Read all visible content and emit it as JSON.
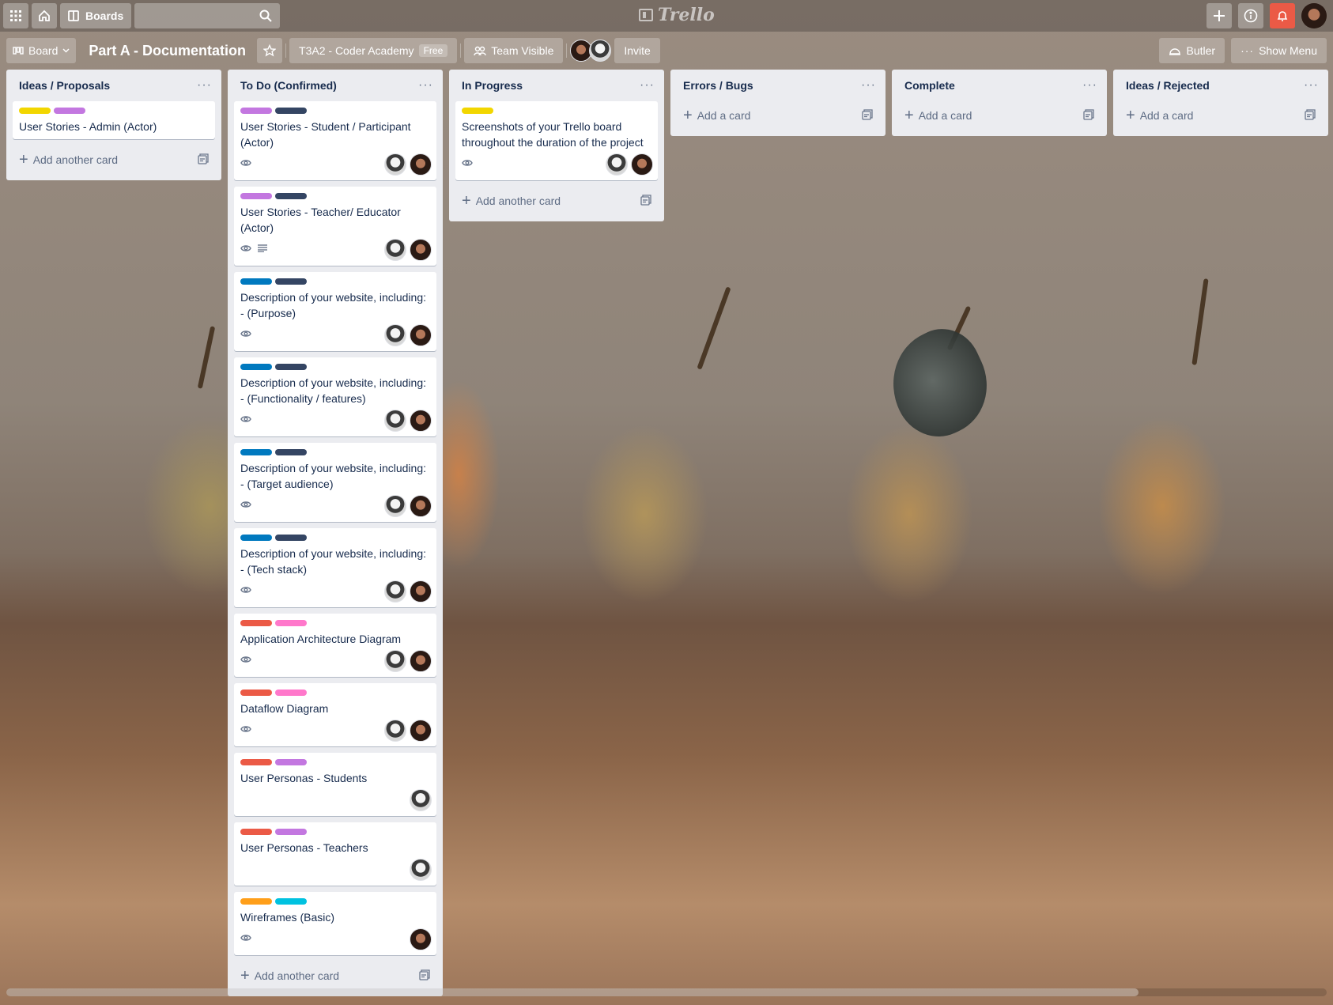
{
  "header": {
    "boards_label": "Boards",
    "logo_text": "Trello"
  },
  "board": {
    "view_label": "Board",
    "title": "Part A - Documentation",
    "team_name": "T3A2 - Coder Academy",
    "team_badge": "Free",
    "visibility": "Team Visible",
    "invite_label": "Invite",
    "butler_label": "Butler",
    "show_menu_label": "Show Menu"
  },
  "colors": {
    "yellow": "#f2d600",
    "purple": "#c377e0",
    "navy": "#344563",
    "blue": "#0079bf",
    "red": "#eb5a46",
    "pink": "#ff78cb",
    "orange": "#ff9f1a",
    "sky": "#00c2e0"
  },
  "lists": [
    {
      "title": "Ideas / Proposals",
      "add_label": "Add another card",
      "cards": [
        {
          "labels": [
            "yellow",
            "purple"
          ],
          "title": "User Stories - Admin (Actor)",
          "badges": [],
          "members": []
        }
      ]
    },
    {
      "title": "To Do (Confirmed)",
      "add_label": "Add another card",
      "cards": [
        {
          "labels": [
            "purple",
            "navy"
          ],
          "title": "User Stories - Student / Participant (Actor)",
          "badges": [
            "eye-icon"
          ],
          "members": [
            "a1",
            "a2"
          ]
        },
        {
          "labels": [
            "purple",
            "navy"
          ],
          "title": "User Stories - Teacher/ Educator (Actor)",
          "badges": [
            "eye-icon",
            "description-icon"
          ],
          "members": [
            "a1",
            "a2"
          ]
        },
        {
          "labels": [
            "blue",
            "navy"
          ],
          "title": "Description of your website, including: - (Purpose)",
          "badges": [
            "eye-icon"
          ],
          "members": [
            "a1",
            "a2"
          ]
        },
        {
          "labels": [
            "blue",
            "navy"
          ],
          "title": "Description of your website, including: - (Functionality / features)",
          "badges": [
            "eye-icon"
          ],
          "members": [
            "a1",
            "a2"
          ]
        },
        {
          "labels": [
            "blue",
            "navy"
          ],
          "title": "Description of your website, including: - (Target audience)",
          "badges": [
            "eye-icon"
          ],
          "members": [
            "a1",
            "a2"
          ]
        },
        {
          "labels": [
            "blue",
            "navy"
          ],
          "title": "Description of your website, including: - (Tech stack)",
          "badges": [
            "eye-icon"
          ],
          "members": [
            "a1",
            "a2"
          ]
        },
        {
          "labels": [
            "red",
            "pink"
          ],
          "title": "Application Architecture Diagram",
          "badges": [
            "eye-icon"
          ],
          "members": [
            "a1",
            "a2"
          ]
        },
        {
          "labels": [
            "red",
            "pink"
          ],
          "title": "Dataflow Diagram",
          "badges": [
            "eye-icon"
          ],
          "members": [
            "a1",
            "a2"
          ]
        },
        {
          "labels": [
            "red",
            "purple"
          ],
          "title": "User Personas - Students",
          "badges": [],
          "members": [
            "a1"
          ]
        },
        {
          "labels": [
            "red",
            "purple"
          ],
          "title": "User Personas - Teachers",
          "badges": [],
          "members": [
            "a1"
          ]
        },
        {
          "labels": [
            "orange",
            "sky"
          ],
          "title": "Wireframes (Basic)",
          "badges": [
            "eye-icon"
          ],
          "members": [
            "a2"
          ]
        }
      ]
    },
    {
      "title": "In Progress",
      "add_label": "Add another card",
      "cards": [
        {
          "labels": [
            "yellow"
          ],
          "title": "Screenshots of your Trello board throughout the duration of the project",
          "badges": [
            "eye-icon"
          ],
          "members": [
            "a1",
            "a2"
          ]
        }
      ]
    },
    {
      "title": "Errors / Bugs",
      "add_label": "Add a card",
      "cards": []
    },
    {
      "title": "Complete",
      "add_label": "Add a card",
      "cards": []
    },
    {
      "title": "Ideas / Rejected",
      "add_label": "Add a card",
      "cards": []
    }
  ]
}
